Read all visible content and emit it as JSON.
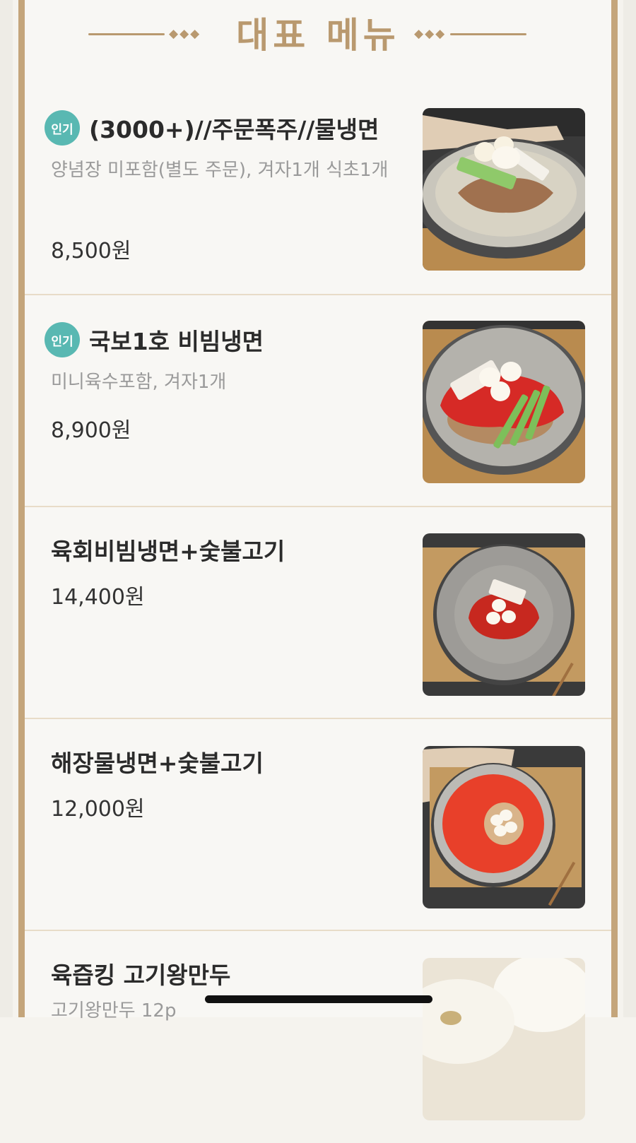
{
  "header": {
    "title": "대표 메뉴",
    "diamonds": "◆◆◆"
  },
  "badge_label": "인기",
  "items": [
    {
      "name": "(3000+)//주문폭주//물냉면",
      "popular": true,
      "description": "양념장 미포함(별도 주문), 겨자1개 식초1개",
      "price": "8,500원",
      "image": "mul-naengmyeon-photo"
    },
    {
      "name": "국보1호 비빔냉면",
      "popular": true,
      "description": "미니육수포함, 겨자1개",
      "price": "8,900원",
      "image": "bibim-naengmyeon-photo"
    },
    {
      "name": "육회비빔냉면+숯불고기",
      "popular": false,
      "description": "",
      "price": "14,400원",
      "image": "yukhoe-bibim-naengmyeon-photo"
    },
    {
      "name": "해장물냉면+숯불고기",
      "popular": false,
      "description": "",
      "price": "12,000원",
      "image": "haejang-mul-naengmyeon-photo"
    },
    {
      "name": "육즙킹 고기왕만두",
      "popular": false,
      "description": "고기왕만두 12p",
      "price": "",
      "image": "mandu-photo"
    }
  ],
  "colors": {
    "accent_gold": "#b9996f",
    "frame_border": "#c4a57b",
    "badge_teal": "#59b8b2",
    "divider": "#e8dcc8"
  }
}
